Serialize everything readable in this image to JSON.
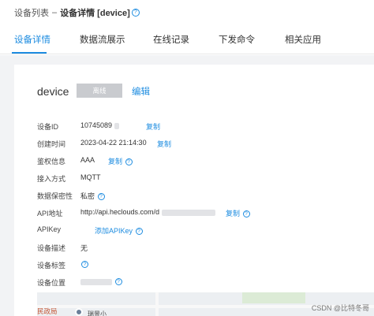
{
  "breadcrumb": {
    "parent": "设备列表",
    "separator": "–",
    "current": "设备详情 [device]",
    "help_icon": "?"
  },
  "tabs": [
    {
      "label": "设备详情",
      "active": true
    },
    {
      "label": "数据流展示",
      "active": false
    },
    {
      "label": "在线记录",
      "active": false
    },
    {
      "label": "下发命令",
      "active": false
    },
    {
      "label": "相关应用",
      "active": false
    }
  ],
  "device": {
    "name": "device",
    "status": "离线",
    "edit_label": "编辑"
  },
  "fields": {
    "device_id": {
      "label": "设备ID",
      "value": "10745089",
      "action": "复制"
    },
    "created_time": {
      "label": "创建时间",
      "value": "2023-04-22 21:14:30",
      "action": "复制"
    },
    "auth_info": {
      "label": "鉴权信息",
      "value": "AAA",
      "action": "复制"
    },
    "access_method": {
      "label": "接入方式",
      "value": "MQTT"
    },
    "data_privacy": {
      "label": "数据保密性",
      "value": "私密"
    },
    "api_address": {
      "label": "API地址",
      "value": "http://api.heclouds.com/d",
      "action": "复制"
    },
    "apikey": {
      "label": "APIKey",
      "action": "添加APIKey"
    },
    "description": {
      "label": "设备描述",
      "value": "无"
    },
    "tags": {
      "label": "设备标签"
    },
    "location": {
      "label": "设备位置"
    }
  },
  "map": {
    "poi_label": "民政局",
    "poi_name": "瑞景小"
  },
  "watermark": "CSDN @比特冬哥",
  "colors": {
    "accent": "#1d8ce0",
    "status_offline_bg": "#c9cbcf",
    "page_bg": "#f2f3f5"
  }
}
